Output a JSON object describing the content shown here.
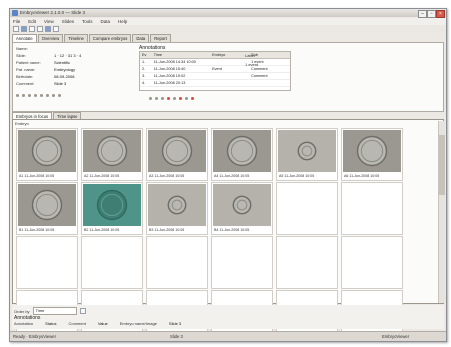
{
  "window": {
    "title": "EmbryoViewer 2.1.0.0 — Slide 3"
  },
  "menu": [
    "File",
    "Edit",
    "View",
    "Slides",
    "Tools",
    "Data",
    "Help"
  ],
  "tabs_top": [
    "Annotate",
    "Overview",
    "Timeline",
    "Compare embryos",
    "Data",
    "Report"
  ],
  "info": {
    "left_fields": [
      {
        "label": "Name:",
        "value": ""
      },
      {
        "label": "Slide:",
        "value": "1 · 12 · 31 3 · 4"
      },
      {
        "label": "Patient name:",
        "value": "Scientific"
      },
      {
        "label": "Pat. name:",
        "value": "Embryology"
      },
      {
        "label": "Birthdate:",
        "value": "08-09-2008"
      },
      {
        "label": "Comment:",
        "value": "Slide 3"
      }
    ],
    "table": {
      "title": "Annotations",
      "headers": [
        "Ev",
        "Time",
        "Embryo",
        "Sub"
      ],
      "rows": [
        [
          "1.",
          "11-Jun-2008 14:34 10:00",
          "",
          "1 event"
        ],
        [
          "2.",
          "11-Jun-2008 15:40",
          "Event",
          "Comment"
        ],
        [
          "3.",
          "11-Jun-2008 19:02",
          "",
          "Comment"
        ],
        [
          "4.",
          "11-Jun-2008 20:13",
          "",
          ""
        ]
      ]
    },
    "right_fields": [
      {
        "label": "Label",
        "value": ""
      },
      {
        "label": "1 event",
        "value": ""
      }
    ]
  },
  "tabs_gallery": [
    "Embryos in focus",
    "Time lapse"
  ],
  "gallery": {
    "label": "Embryo",
    "images": [
      {
        "caption": "A1 11-Jun-2008 10:05",
        "style": "gray"
      },
      {
        "caption": "A2 11-Jun-2008 10:05",
        "style": "gray"
      },
      {
        "caption": "A3 11-Jun-2008 10:05",
        "style": "gray"
      },
      {
        "caption": "A4 11-Jun-2008 10:05",
        "style": "gray"
      },
      {
        "caption": "A5 11-Jun-2008 10:05",
        "style": "light"
      },
      {
        "caption": "A6 11-Jun-2008 10:05",
        "style": "gray"
      },
      {
        "caption": "B1 11-Jun-2008 10:05",
        "style": "gray"
      },
      {
        "caption": "B2 11-Jun-2008 10:05",
        "style": "teal"
      },
      {
        "caption": "B3 11-Jun-2008 10:05",
        "style": "light"
      },
      {
        "caption": "B4 11-Jun-2008 10:05",
        "style": "light"
      }
    ],
    "empty_cells": 14
  },
  "bottom": {
    "sort_label": "Order by",
    "sort_value": "Time",
    "section_label": "Annotations",
    "fields": [
      {
        "label": "Annotation",
        "value": "Status"
      },
      {
        "label": "Comment",
        "value": "Value"
      },
      {
        "label": "Embryo name/Image",
        "value": "Slide 3"
      }
    ]
  },
  "status": {
    "left": "Ready · EmbryoViewer",
    "mid": "Slide 3",
    "right": "EmbryoViewer"
  },
  "colors": {
    "accent": "#5a86c8",
    "frame": "#ece9e4",
    "highlight_red": "#d24c3c"
  }
}
